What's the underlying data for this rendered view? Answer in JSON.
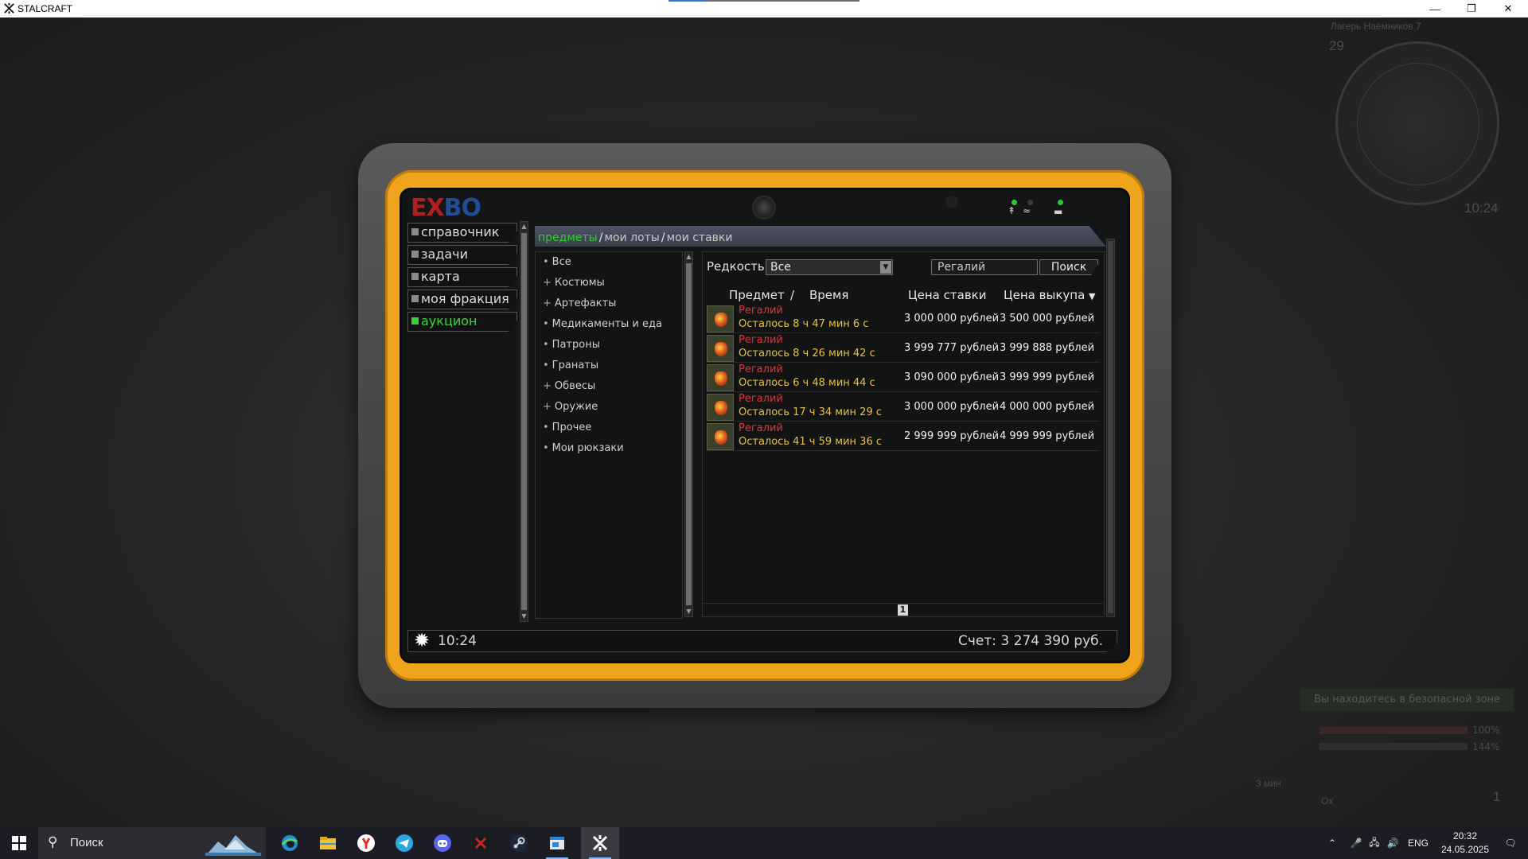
{
  "window": {
    "title": "STALCRAFT",
    "controls": [
      "minimize-icon",
      "restore-icon",
      "close-icon"
    ]
  },
  "hud": {
    "location": "Лагерь Наёмников 7",
    "minimap_number": "29",
    "clock": "10:24",
    "safe_zone_text": "Вы находитесь в безопасной зоне",
    "health_pct": "100%",
    "stamina_pct": "144%",
    "hotkey_label": "3 мин",
    "slot_count": "1",
    "slot_label": "Ох"
  },
  "tablet": {
    "logo_part1": "EX",
    "logo_part2": "BO",
    "menu": [
      {
        "label": "справочник",
        "active": false
      },
      {
        "label": "задачи",
        "active": false
      },
      {
        "label": "карта",
        "active": false
      },
      {
        "label": "моя фракция",
        "active": false
      },
      {
        "label": "аукцион",
        "active": true
      }
    ],
    "breadcrumb": {
      "active": "предметы",
      "items": [
        "мои лоты",
        "мои ставки"
      ],
      "separator": "/"
    },
    "categories": [
      {
        "marker": "•",
        "label": "Все"
      },
      {
        "marker": "+",
        "label": "Костюмы"
      },
      {
        "marker": "+",
        "label": "Артефакты"
      },
      {
        "marker": "•",
        "label": "Медикаменты и еда"
      },
      {
        "marker": "•",
        "label": "Патроны"
      },
      {
        "marker": "•",
        "label": "Гранаты"
      },
      {
        "marker": "+",
        "label": "Обвесы"
      },
      {
        "marker": "+",
        "label": "Оружие"
      },
      {
        "marker": "•",
        "label": "Прочее"
      },
      {
        "marker": "•",
        "label": "Мои рюкзаки"
      }
    ],
    "filters": {
      "rarity_label": "Редкость",
      "rarity_value": "Все",
      "search_value": "Регалий",
      "search_button": "Поиск"
    },
    "columns": {
      "item": "Предмет",
      "slash": "/",
      "time": "Время",
      "bid": "Цена ставки",
      "buyout": "Цена выкупа",
      "sort_marker": "▼"
    },
    "lots": [
      {
        "name": "Регалий",
        "time": "Осталось 8 ч 47 мин 6 с",
        "bid": "3 000 000 рублей",
        "buyout": "3 500 000 рублей"
      },
      {
        "name": "Регалий",
        "time": "Осталось 8 ч 26 мин 42 с",
        "bid": "3 999 777 рублей",
        "buyout": "3 999 888 рублей"
      },
      {
        "name": "Регалий",
        "time": "Осталось 6 ч 48 мин 44 с",
        "bid": "3 090 000 рублей",
        "buyout": "3 999 999 рублей"
      },
      {
        "name": "Регалий",
        "time": "Осталось 17 ч 34 мин 29 с",
        "bid": "3 000 000 рублей",
        "buyout": "4 000 000 рублей"
      },
      {
        "name": "Регалий",
        "time": "Осталось 41 ч 59 мин 36 с",
        "bid": "2 999 999 рублей",
        "buyout": "4 999 999 рублей"
      }
    ],
    "page": "1",
    "status": {
      "time": "10:24",
      "balance": "Счет: 3 274 390 руб."
    },
    "colors": {
      "frame": "#f0a41c",
      "active_menu": "#3bd13b",
      "lot_name": "#e23434",
      "lot_time": "#e8c23a"
    }
  },
  "taskbar": {
    "search_placeholder": "Поиск",
    "apps": [
      "edge-icon",
      "file-explorer-icon",
      "yandex-browser-icon",
      "telegram-icon",
      "discord-icon",
      "exbo-launcher-icon",
      "steam-icon",
      "window-app-icon",
      "stalcraft-icon"
    ],
    "active_app": "stalcraft-icon",
    "language": "ENG",
    "time": "20:32",
    "date": "24.05.2025"
  }
}
